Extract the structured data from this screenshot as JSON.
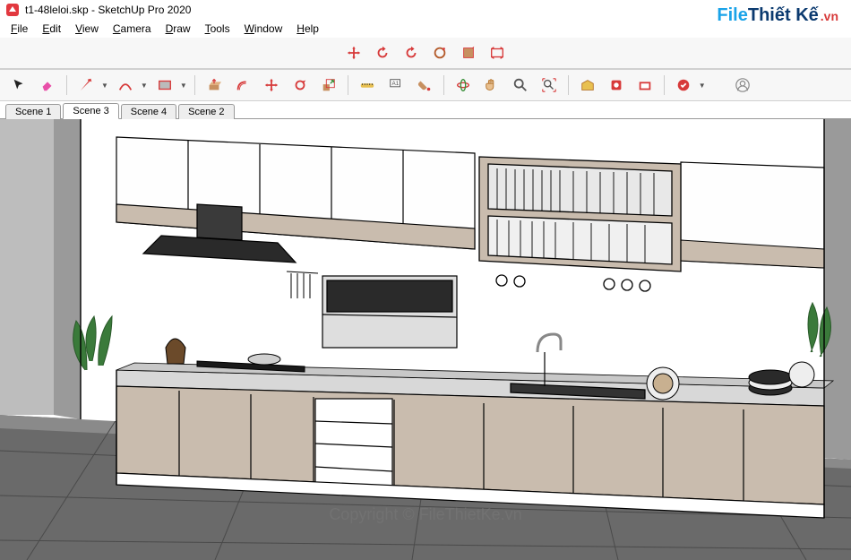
{
  "title": {
    "filename": "t1-48leloi.skp",
    "app": "SketchUp Pro 2020"
  },
  "menus": [
    "File",
    "Edit",
    "View",
    "Camera",
    "Draw",
    "Tools",
    "Window",
    "Help"
  ],
  "scenes": [
    {
      "label": "Scene 1",
      "active": false
    },
    {
      "label": "Scene 3",
      "active": true
    },
    {
      "label": "Scene 4",
      "active": false
    },
    {
      "label": "Scene 2",
      "active": false
    }
  ],
  "logo": {
    "part1": "File",
    "part2": "Thiết Kế",
    "part3": ".vn"
  },
  "copyright": "Copyright © FileThietKe.vn",
  "toolbar_top": [
    {
      "name": "move-icon",
      "color": "#d73a3a"
    },
    {
      "name": "rotate-left-icon",
      "color": "#d73a3a"
    },
    {
      "name": "rotate-right-icon",
      "color": "#d73a3a"
    },
    {
      "name": "orbit-icon",
      "color": "#c05a2a"
    },
    {
      "name": "pan-icon",
      "color": "#b35a2a"
    },
    {
      "name": "zoom-extents-icon",
      "color": "#b35a2a"
    }
  ],
  "toolbar_main": [
    {
      "name": "select-icon"
    },
    {
      "name": "eraser-icon"
    },
    {
      "name": "line-icon",
      "drop": true
    },
    {
      "name": "arc-icon",
      "drop": true
    },
    {
      "name": "rectangle-icon",
      "drop": true
    },
    {
      "name": "circle-icon",
      "drop": true
    },
    {
      "name": "pushpull-icon"
    },
    {
      "name": "offset-icon"
    },
    {
      "name": "move-tool-icon"
    },
    {
      "name": "rotate-tool-icon"
    },
    {
      "name": "scale-icon"
    },
    {
      "name": "tape-icon"
    },
    {
      "name": "text-icon"
    },
    {
      "name": "paint-icon"
    },
    {
      "name": "orbit-tool-icon"
    },
    {
      "name": "pan-tool-icon"
    },
    {
      "name": "zoom-icon"
    },
    {
      "name": "zoom-extents-tool-icon"
    },
    {
      "name": "warehouse-icon"
    },
    {
      "name": "extension-icon"
    },
    {
      "name": "component-icon"
    },
    {
      "name": "layer-icon"
    },
    {
      "name": "plugin-icon",
      "drop": true
    },
    {
      "name": "user-icon"
    }
  ]
}
